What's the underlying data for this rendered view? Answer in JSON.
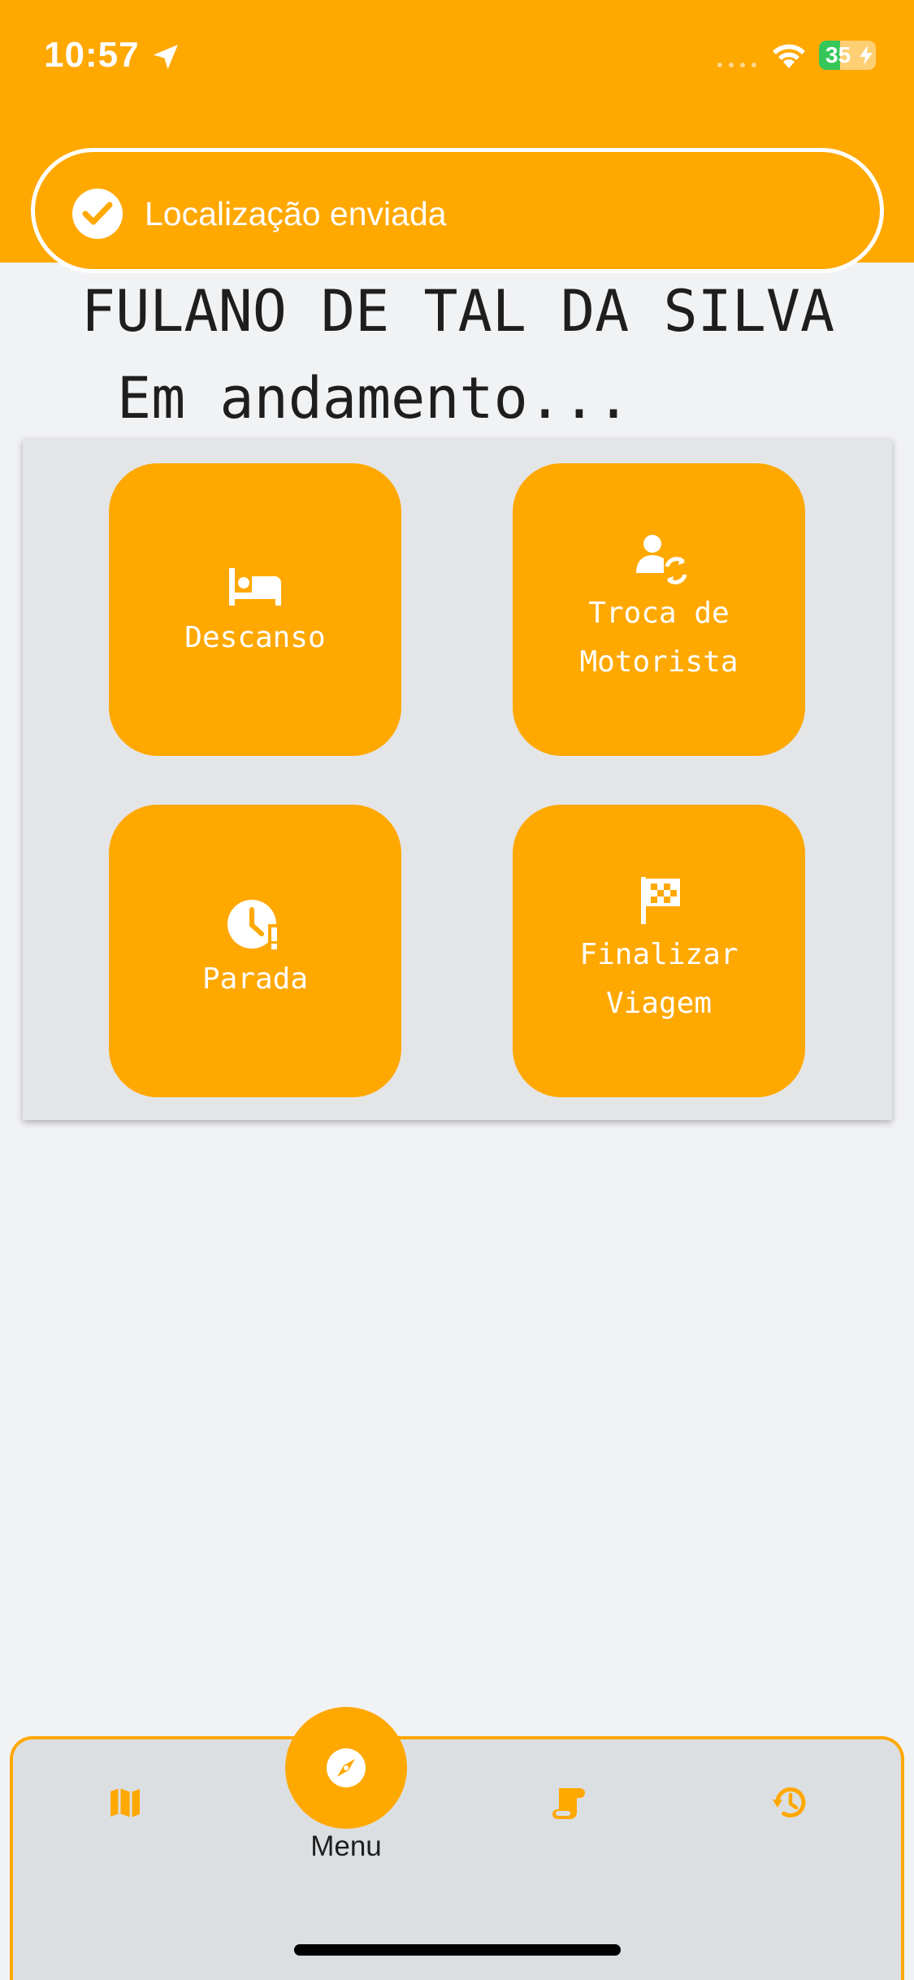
{
  "status_bar": {
    "time": "10:57",
    "battery_percent": "35",
    "icons": [
      "location-arrow-icon",
      "cellular-signal-icon",
      "wifi-icon",
      "battery-charging-icon"
    ]
  },
  "toast": {
    "message": "Localização enviada",
    "icon": "check-circle-icon"
  },
  "driver": {
    "name": "FULANO DE TAL DA SILVA",
    "trip_status": "Em andamento..."
  },
  "actions": [
    {
      "label": "Descanso",
      "icon": "bed-icon"
    },
    {
      "label": "Troca de Motorista",
      "icon": "user-swap-icon"
    },
    {
      "label": "Parada",
      "icon": "clock-alert-icon"
    },
    {
      "label": "Finalizar Viagem",
      "icon": "checkered-flag-icon"
    }
  ],
  "bottom_nav": {
    "items": [
      {
        "icon": "map-icon"
      },
      {
        "icon": "compass-icon",
        "label": "Menu",
        "active": true
      },
      {
        "icon": "scroll-icon"
      },
      {
        "icon": "history-icon"
      }
    ]
  },
  "colors": {
    "primary": "#ffa800",
    "background": "#f1f2f4",
    "panel": "#e4e5e7",
    "nav_background": "#dcdfe2",
    "text_dark": "#1e1e1e",
    "battery_green": "#35c759"
  }
}
